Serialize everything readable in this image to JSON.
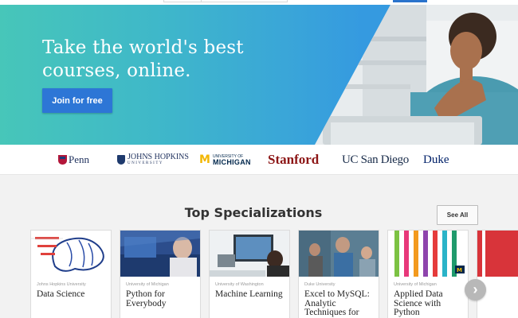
{
  "hero": {
    "title": "Take the world's best courses, online.",
    "cta": "Join for free"
  },
  "partners": {
    "penn": "Penn",
    "jhu_line1": "JOHNS HOPKINS",
    "jhu_line2": "UNIVERSITY",
    "um_line1": "UNIVERSITY OF",
    "um_line2": "MICHIGAN",
    "um_mark": "M",
    "stanford": "Stanford",
    "ucsd": "UC San Diego",
    "duke": "Duke"
  },
  "specializations": {
    "title": "Top Specializations",
    "see_all": "See All",
    "next_arrow": "›",
    "cards": [
      {
        "university": "Johns Hopkins University",
        "name": "Data Science"
      },
      {
        "university": "University of Michigan",
        "name": "Python for Everybody"
      },
      {
        "university": "University of Washington",
        "name": "Machine Learning"
      },
      {
        "university": "Duke University",
        "name": "Excel to MySQL: Analytic Techniques for Business"
      },
      {
        "university": "University of Michigan",
        "name": "Applied Data Science with Python"
      }
    ]
  },
  "colors": {
    "hero_start": "#47c6b9",
    "hero_end": "#359ae0",
    "cta": "#2d76d6",
    "stanford": "#8c1515",
    "michigan_maize": "#f2b705"
  }
}
